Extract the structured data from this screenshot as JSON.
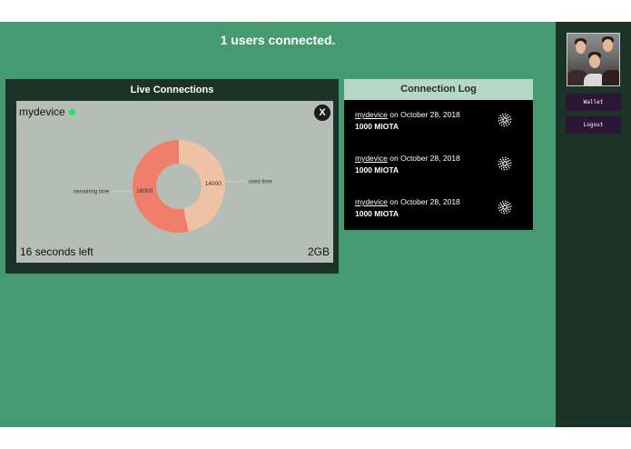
{
  "header": {
    "title": "1 users connected."
  },
  "live_connections": {
    "title": "Live Connections",
    "device": {
      "name": "mydevice",
      "close_label": "X",
      "time_left": "16 seconds left",
      "data_size": "2GB",
      "status_color": "#22e35c"
    },
    "chart_data": {
      "type": "pie",
      "categories": [
        "remaining time",
        "used time"
      ],
      "values": [
        16000,
        14000
      ],
      "colors": [
        "#ef7e6a",
        "#edc2a5"
      ],
      "donut": true
    }
  },
  "connection_log": {
    "title": "Connection Log",
    "items": [
      {
        "device": "mydevice",
        "date_text": " on October 28, 2018",
        "amount": "1000 MIOTA",
        "icon": "iota-icon"
      },
      {
        "device": "mydevice",
        "date_text": " on October 28, 2018",
        "amount": "1000 MIOTA",
        "icon": "iota-icon"
      },
      {
        "device": "mydevice",
        "date_text": " on October 28, 2018",
        "amount": "1000 MIOTA",
        "icon": "iota-icon"
      }
    ]
  },
  "sidebar": {
    "avatar": "team-photo",
    "wallet_label": "Wallet",
    "logout_label": "Logout"
  },
  "colors": {
    "main_bg": "#469a71",
    "sidebar_bg": "#1c3427",
    "panel_bg": "#1c3427",
    "card_bg": "#b6bdb7",
    "button_bg": "#2c1537"
  }
}
